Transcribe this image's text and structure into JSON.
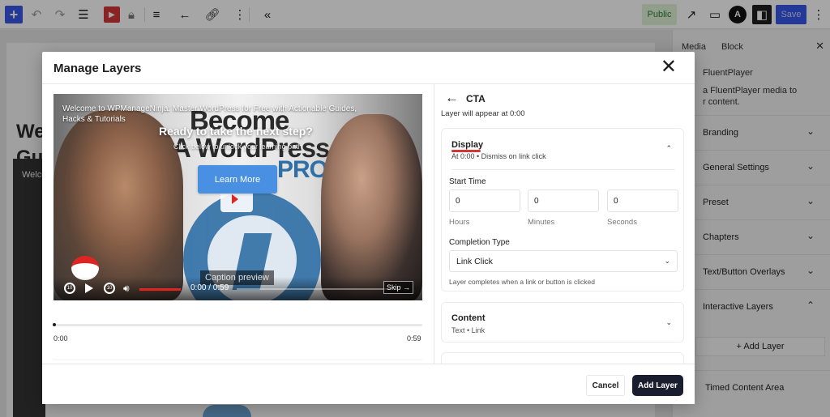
{
  "toolbar": {
    "add_icon": "plus-icon",
    "public_label": "Public",
    "save_label": "Save"
  },
  "canvas": {
    "heading_line1": "We",
    "heading_line2": "Gu",
    "video_label": "Welco"
  },
  "sidebar": {
    "tabs": [
      "Media",
      "Block"
    ],
    "plugin_name": "FluentPlayer",
    "description_line1": "a FluentPlayer media to",
    "description_line2": "r content.",
    "items": [
      {
        "label": "Branding",
        "chevron": "⌄"
      },
      {
        "label": "General Settings",
        "chevron": "⌄"
      },
      {
        "label": "Preset",
        "chevron": "⌄"
      },
      {
        "label": "Chapters",
        "chevron": "⌄"
      },
      {
        "label": "Text/Button Overlays",
        "chevron": "⌄"
      },
      {
        "label": "Interactive Layers",
        "chevron": "⌃"
      }
    ],
    "add_layer_label": "+ Add Layer",
    "timed_content_label": "Timed Content Area"
  },
  "modal": {
    "title": "Manage Layers",
    "close_glyph": "✕"
  },
  "video": {
    "title": "Welcome to WPManageNinja: Master WordPress for Free with Actionable Guides, Hacks & Tutorials",
    "cta_heading": "Ready to take the next step?",
    "cta_subtext": "Click below to unlock your learning path",
    "thumb_line1": "Become",
    "thumb_line2": "A WordPress",
    "thumb_line3": "PRO",
    "learn_more_label": "Learn More",
    "caption_preview": "Caption preview",
    "time_display": "0:00 / 0:59",
    "rewind_label": "10",
    "forward_label": "10",
    "skip_label": "Skip →",
    "volume_fraction": 0.85
  },
  "timeline": {
    "start_label": "0:00",
    "end_label": "0:59"
  },
  "settings": {
    "back_glyph": "←",
    "layer_name": "CTA",
    "appear_text": "Layer will appear at 0:00",
    "display_title": "Display",
    "display_subtitle": "At 0:00 • Dismiss on link click",
    "start_time_label": "Start Time",
    "hours_value": "0",
    "minutes_value": "0",
    "seconds_value": "0",
    "hours_label": "Hours",
    "minutes_label": "Minutes",
    "seconds_label": "Seconds",
    "completion_type_label": "Completion Type",
    "completion_type_value": "Link Click",
    "completion_help": "Layer completes when a link or button is clicked",
    "content_title": "Content",
    "content_subtitle": "Text • Link"
  },
  "footer": {
    "cancel_label": "Cancel",
    "add_layer_label": "Add Layer"
  },
  "colors": {
    "wp_blue": "#3858e9",
    "accent_red": "#d63638",
    "primary_dark": "#1a1d2e",
    "public_green_bg": "#dff3d8"
  }
}
